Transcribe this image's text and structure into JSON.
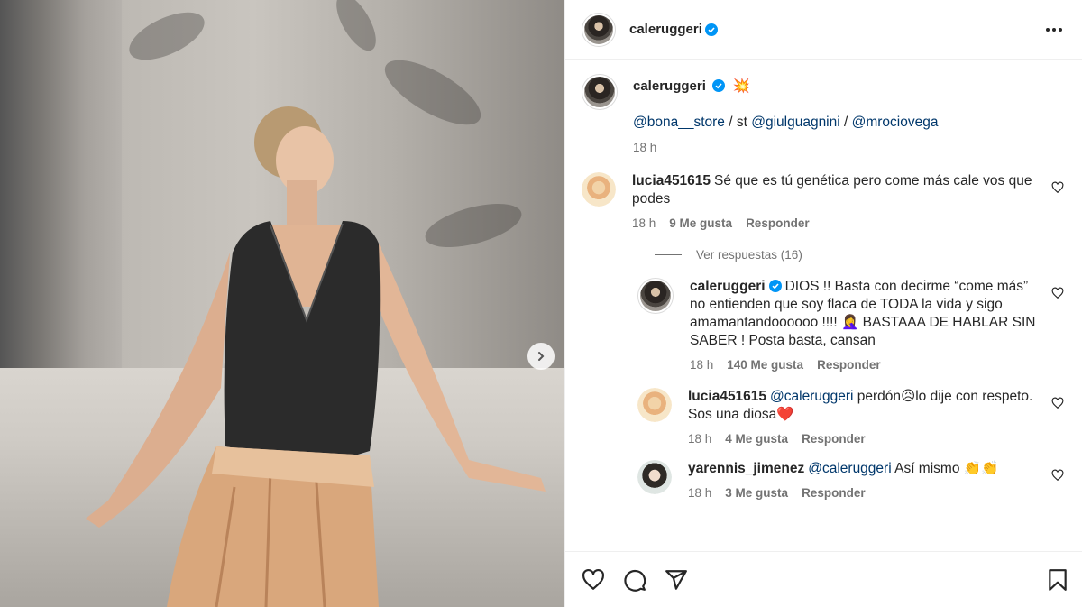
{
  "colors": {
    "verified": "#0095f6",
    "link": "#00376b",
    "muted": "#737373",
    "like_heart": "#e0245e"
  },
  "post_owner": {
    "username": "caleruggeri",
    "verified": true
  },
  "caption": {
    "username": "caleruggeri",
    "emoji": "💥",
    "mention1": "@bona__store",
    "sep1": " / st ",
    "mention2": "@giulguagnini",
    "sep2": " / ",
    "mention3": "@mrociovega",
    "time": "18 h"
  },
  "comment1": {
    "username": "lucia451615",
    "text": "Sé que es tú genética pero come más cale vos que podes",
    "time": "18 h",
    "likes": "9 Me gusta",
    "reply_label": "Responder"
  },
  "view_replies": {
    "label": "Ver respuestas (16)"
  },
  "reply1": {
    "username": "caleruggeri",
    "text": "DIOS !! Basta con decirme “come más” no entienden que soy flaca de TODA la vida y sigo amamantandoooooo !!!! 🤦‍♀️ BASTAAA DE HABLAR SIN SABER ! Posta basta, cansan",
    "time": "18 h",
    "likes": "140 Me gusta",
    "reply_label": "Responder"
  },
  "reply2": {
    "username": "lucia451615",
    "mention": "@caleruggeri",
    "text": " perdón😥lo dije con respeto. Sos una diosa❤️",
    "time": "18 h",
    "likes": "4 Me gusta",
    "reply_label": "Responder"
  },
  "reply3": {
    "username": "yarennis_jimenez",
    "mention": "@caleruggeri",
    "text": " Así mismo 👏👏",
    "time": "18 h",
    "likes": "3 Me gusta",
    "reply_label": "Responder"
  },
  "icons": {
    "like": "heart-icon",
    "comment": "comment-icon",
    "share": "share-icon",
    "save": "bookmark-icon",
    "more": "more-options-icon",
    "next": "chevron-right-icon"
  }
}
